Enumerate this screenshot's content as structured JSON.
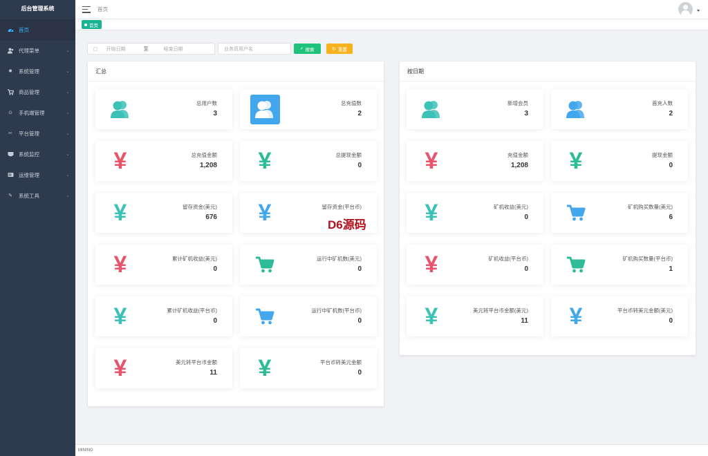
{
  "app": {
    "title": "后台管理系统"
  },
  "sidebar": {
    "items": [
      {
        "label": "首页",
        "icon": "dashboard-icon",
        "active": true
      },
      {
        "label": "代理菜单",
        "icon": "user-icon"
      },
      {
        "label": "系统管理",
        "icon": "gear-icon"
      },
      {
        "label": "商品管理",
        "icon": "cart-icon"
      },
      {
        "label": "手机端管理",
        "icon": "mobile-icon"
      },
      {
        "label": "平台管理",
        "icon": "tools-icon"
      },
      {
        "label": "系统监控",
        "icon": "monitor-icon"
      },
      {
        "label": "运维管理",
        "icon": "server-icon"
      },
      {
        "label": "系统工具",
        "icon": "wrench-icon"
      }
    ]
  },
  "topbar": {
    "breadcrumb": "首页"
  },
  "tabs": [
    {
      "label": "首页"
    }
  ],
  "filter": {
    "start_placeholder": "开始日期",
    "separator": "至",
    "end_placeholder": "结束日期",
    "user_placeholder": "业务员用户名",
    "search_label": "搜索",
    "reset_label": "重置"
  },
  "summary": {
    "title": "汇总",
    "cards": [
      {
        "label": "总用户数",
        "value": "3",
        "icon": "users-icon",
        "color": "#3cc1b7"
      },
      {
        "label": "总充值数",
        "value": "2",
        "icon": "users-box-icon",
        "color": "#43a7ee"
      },
      {
        "label": "总充值金额",
        "value": "1,208",
        "icon": "yen-icon",
        "color": "#e8546b"
      },
      {
        "label": "总提现金额",
        "value": "0",
        "icon": "yen-icon",
        "color": "#2dbb98"
      },
      {
        "label": "留存资金(美元)",
        "value": "676",
        "icon": "yen-icon",
        "color": "#3cc1b7"
      },
      {
        "label": "留存资金(平台币)",
        "value": "",
        "icon": "yen-icon",
        "color": "#43a7ee"
      },
      {
        "label": "累计矿机收益(美元)",
        "value": "0",
        "icon": "yen-icon",
        "color": "#e8546b"
      },
      {
        "label": "运行中矿机数(美元)",
        "value": "0",
        "icon": "cart-icon",
        "color": "#2dbb98"
      },
      {
        "label": "累计矿机收益(平台币)",
        "value": "0",
        "icon": "yen-icon",
        "color": "#3cc1b7"
      },
      {
        "label": "运行中矿机数(平台币)",
        "value": "0",
        "icon": "cart-icon",
        "color": "#43a7ee"
      },
      {
        "label": "美元转平台币金额",
        "value": "11",
        "icon": "yen-icon",
        "color": "#e8546b"
      },
      {
        "label": "平台币转美元金额",
        "value": "0",
        "icon": "yen-icon",
        "color": "#2dbb98"
      }
    ]
  },
  "by_date": {
    "title": "按日期",
    "cards": [
      {
        "label": "新增会员",
        "value": "3",
        "icon": "users-icon",
        "color": "#3cc1b7"
      },
      {
        "label": "首充人数",
        "value": "2",
        "icon": "users-icon",
        "color": "#43a7ee"
      },
      {
        "label": "充值金额",
        "value": "1,208",
        "icon": "yen-icon",
        "color": "#e8546b"
      },
      {
        "label": "提现金额",
        "value": "0",
        "icon": "yen-icon",
        "color": "#2dbb98"
      },
      {
        "label": "矿机收益(美元)",
        "value": "0",
        "icon": "yen-icon",
        "color": "#3cc1b7"
      },
      {
        "label": "矿机购买数量(美元)",
        "value": "6",
        "icon": "cart-icon",
        "color": "#43a7ee"
      },
      {
        "label": "矿机收益(平台币)",
        "value": "0",
        "icon": "yen-icon",
        "color": "#e8546b"
      },
      {
        "label": "矿机购买数量(平台币)",
        "value": "1",
        "icon": "cart-icon",
        "color": "#2dbb98"
      },
      {
        "label": "美元转平台币金额(美元)",
        "value": "11",
        "icon": "yen-icon",
        "color": "#3cc1b7"
      },
      {
        "label": "平台币转美元金额(美元)",
        "value": "0",
        "icon": "yen-icon",
        "color": "#43a7ee"
      }
    ]
  },
  "watermark": "D6源码",
  "footer": {
    "text": "MINING"
  }
}
